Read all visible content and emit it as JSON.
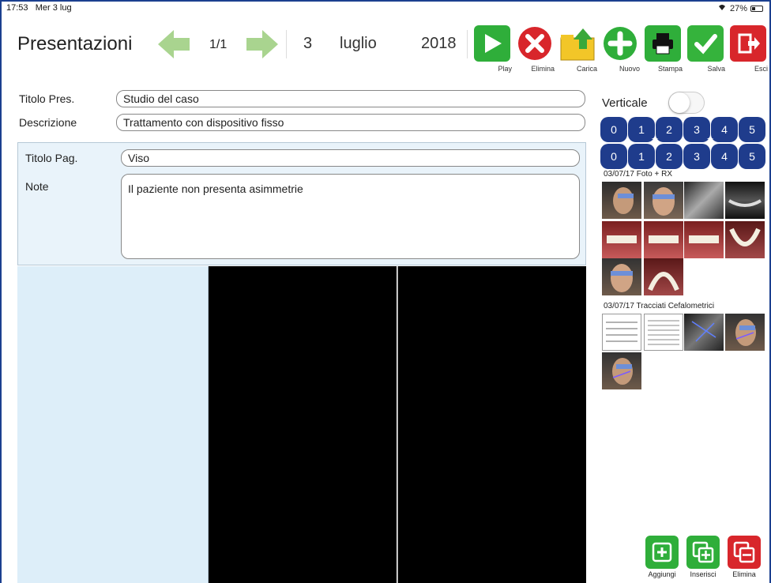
{
  "status": {
    "time": "17:53",
    "date": "Mer 3 lug",
    "battery": "27%"
  },
  "header": {
    "title": "Presentazioni",
    "page": "1/1",
    "day": "3",
    "month": "luglio",
    "year": "2018"
  },
  "toolbar": [
    {
      "label": "Play",
      "icon": "play-icon",
      "color": "#2fae3a"
    },
    {
      "label": "Elimina",
      "icon": "delete-icon",
      "color": "#d8262b"
    },
    {
      "label": "Carica",
      "icon": "upload-folder-icon",
      "color": "#f2c628"
    },
    {
      "label": "Nuovo",
      "icon": "add-icon",
      "color": "#2fae3a"
    },
    {
      "label": "Stampa",
      "icon": "print-icon",
      "color": "#2fae3a"
    },
    {
      "label": "Salva",
      "icon": "save-check-icon",
      "color": "#35b33c"
    },
    {
      "label": "Esci",
      "icon": "exit-icon",
      "color": "#d8262b"
    }
  ],
  "form": {
    "title_label": "Titolo Pres.",
    "title_value": "Studio del caso",
    "desc_label": "Descrizione",
    "desc_value": "Trattamento con dispositivo fisso",
    "page_title_label": "Titolo Pag.",
    "page_title_value": "Viso",
    "note_label": "Note",
    "note_value": "Il paziente non presenta asimmetrie"
  },
  "right": {
    "vertical_label": "Verticale",
    "numbers_row1": [
      "0",
      "1",
      "2",
      "3",
      "4",
      "5"
    ],
    "numbers_row2": [
      "0",
      "1",
      "2",
      "3",
      "4",
      "5"
    ],
    "section1": "03/07/17 Foto + RX",
    "section2": "03/07/17 Tracciati Cefalometrici"
  },
  "bottom": [
    {
      "label": "Aggiungi",
      "icon": "add-page-icon",
      "color": "#2fae3a"
    },
    {
      "label": "Inserisci",
      "icon": "insert-page-icon",
      "color": "#2fae3a"
    },
    {
      "label": "Elimina",
      "icon": "remove-page-icon",
      "color": "#d8262b"
    }
  ]
}
